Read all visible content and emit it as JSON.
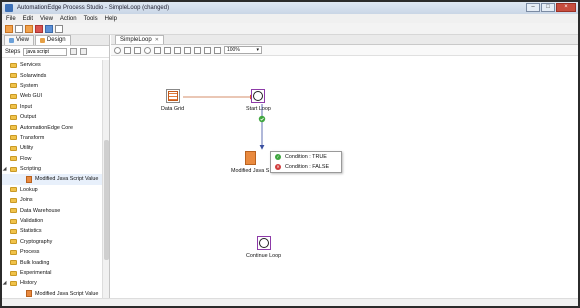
{
  "window": {
    "title": "AutomationEdge Process Studio - SimpleLoop (changed)",
    "buttons": [
      "–",
      "□",
      "×"
    ]
  },
  "menu": [
    "File",
    "Edit",
    "View",
    "Action",
    "Tools",
    "Help"
  ],
  "left_panel": {
    "tabs": [
      {
        "label": "View"
      },
      {
        "label": "Design"
      }
    ],
    "steps_label": "Steps",
    "search_value": "java script",
    "tree": [
      {
        "label": "Services"
      },
      {
        "label": "Solarwinds"
      },
      {
        "label": "System"
      },
      {
        "label": "Web GUI"
      },
      {
        "label": "Input"
      },
      {
        "label": "Output"
      },
      {
        "label": "AutomationEdge Core"
      },
      {
        "label": "Transform"
      },
      {
        "label": "Utility"
      },
      {
        "label": "Flow"
      },
      {
        "label": "Scripting"
      },
      {
        "label": "Modified Java Script Value"
      },
      {
        "label": "Lookup"
      },
      {
        "label": "Joins"
      },
      {
        "label": "Data Warehouse"
      },
      {
        "label": "Validation"
      },
      {
        "label": "Statistics"
      },
      {
        "label": "Cryptography"
      },
      {
        "label": "Process"
      },
      {
        "label": "Bulk loading"
      },
      {
        "label": "Experimental"
      },
      {
        "label": "History"
      },
      {
        "label": "Modified Java Script Value"
      }
    ]
  },
  "editor": {
    "tab_label": "SimpleLoop",
    "zoom": "100%",
    "nodes": {
      "data_grid": "Data Grid",
      "start_loop": "Start Loop",
      "modified_js": "Modified Java S",
      "continue_loop": "Continue Loop"
    },
    "popup": {
      "true_label": "Condition : TRUE",
      "false_label": "Condition : FALSE"
    }
  },
  "colors": {
    "loop_border": "#8d3aa8",
    "hop_arrow": "#e05a2a",
    "connector": "#3a4fa0",
    "ok": "#3fa63f",
    "error": "#d03a3a"
  }
}
